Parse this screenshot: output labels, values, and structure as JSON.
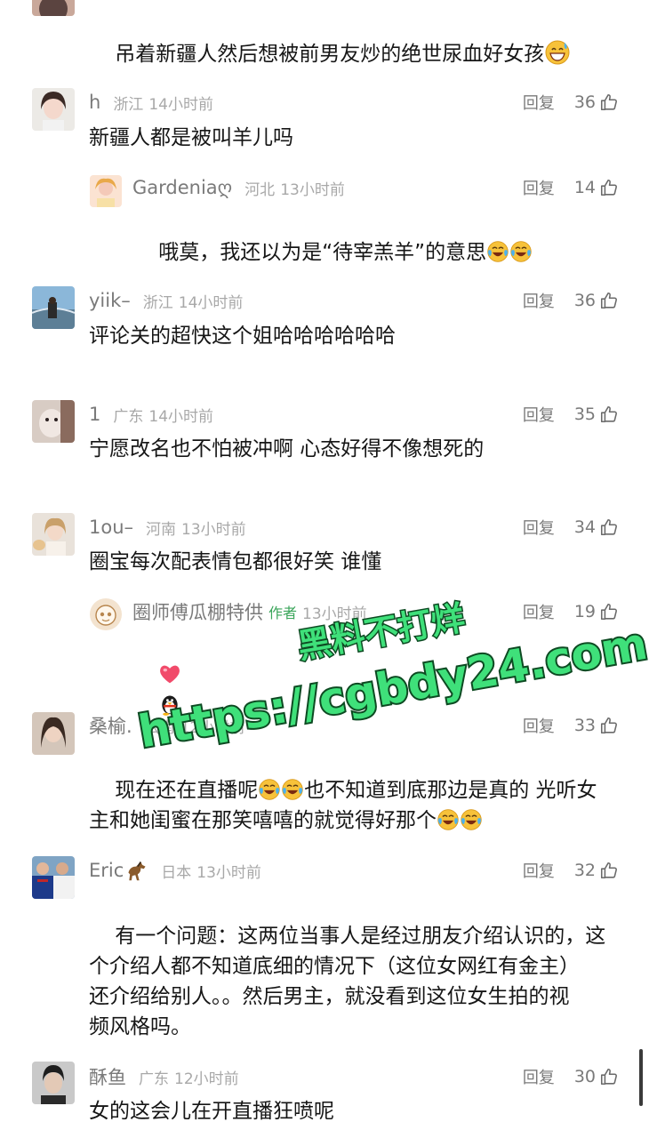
{
  "comments": [
    {
      "text": "吊着新疆人然后想被前男友炒的绝世尿血好女孩",
      "text_emoji": "grinning-sweat-emoji"
    },
    {
      "user": "h",
      "region": "浙江",
      "time": "14小时前",
      "reply_label": "回复",
      "likes": "36",
      "text": "新疆人都是被叫羊儿吗",
      "reply": {
        "user": "Gardenia",
        "user_suffix": "ღ",
        "region": "河北",
        "time": "13小时前",
        "reply_label": "回复",
        "likes": "14",
        "text": "哦莫，我还以为是“待宰羔羊”的意思"
      }
    },
    {
      "user": "yiik–",
      "region": "浙江",
      "time": "14小时前",
      "reply_label": "回复",
      "likes": "36",
      "text": "评论关的超快这个姐哈哈哈哈哈哈"
    },
    {
      "user": "1",
      "region": "广东",
      "time": "14小时前",
      "reply_label": "回复",
      "likes": "35",
      "text": "宁愿改名也不怕被冲啊 心态好得不像想死的"
    },
    {
      "user": "1ou–",
      "region": "河南",
      "time": "13小时前",
      "reply_label": "回复",
      "likes": "34",
      "text": "圈宝每次配表情包都很好笑 谁懂",
      "reply": {
        "user": "圈师傅瓜棚特供",
        "author_tag": "作者",
        "time": "13小时前",
        "reply_label": "回复",
        "likes": "19",
        "emoji": [
          "heart-emoji",
          "penguin-emoji"
        ]
      }
    },
    {
      "user": "桑榆.",
      "region": "云南",
      "time": "12小时前",
      "reply_label": "回复",
      "likes": "33",
      "line1a": "现在还在直播呢",
      "line1b": "也不知道到底那边是真的 光听女",
      "line2": "主和她闺蜜在那笑嘻嘻的就觉得好那个"
    },
    {
      "user": "Eric",
      "user_emoji": "horse-emoji",
      "region": "日本",
      "time": "13小时前",
      "reply_label": "回复",
      "likes": "32",
      "lines": [
        "有一个问题：这两位当事人是经过朋友介绍认识的，这",
        "个介绍人都不知道底细的情况下（这位女网红有金主）",
        "还介绍给别人。。然后男主，就没看到这位女生拍的视",
        "频风格吗。"
      ]
    },
    {
      "user": "酥鱼",
      "region": "广东",
      "time": "12小时前",
      "reply_label": "回复",
      "likes": "30",
      "text": "女的这会儿在开直播狂喷呢"
    }
  ],
  "watermark": {
    "line1": "黑料不打烊",
    "line2": "https://cgbdy24.com",
    "color": "#3fe07a"
  },
  "colors": {
    "text": "#161616",
    "meta": "#a8a8a8",
    "author_tag": "#3aa55a"
  }
}
